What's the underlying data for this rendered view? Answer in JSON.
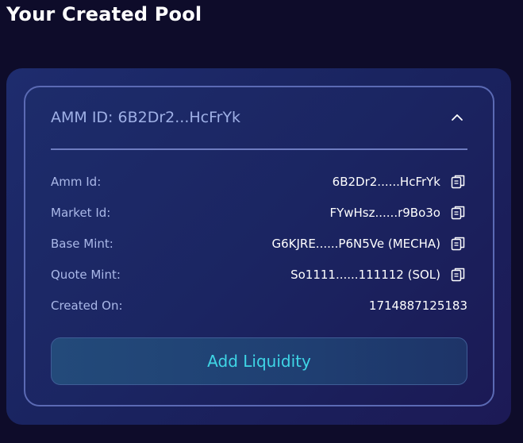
{
  "page_title": "Your Created Pool",
  "card": {
    "header_title": "AMM ID: 6B2Dr2...HcFrYk",
    "rows": [
      {
        "label": "Amm Id:",
        "value": "6B2Dr2......HcFrYk"
      },
      {
        "label": "Market Id:",
        "value": "FYwHsz......r9Bo3o"
      },
      {
        "label": "Base Mint:",
        "value": "G6KJRE......P6N5Ve (MECHA)"
      },
      {
        "label": "Quote Mint:",
        "value": "So1111......111112 (SOL)"
      },
      {
        "label": "Created On:",
        "value": "1714887125183"
      }
    ],
    "add_liquidity_label": "Add Liquidity"
  },
  "colors": {
    "background": "#0e0c2a",
    "accent": "#3fd6e6",
    "label": "#aab8e8",
    "border": "#5b6ab4"
  },
  "icons": {
    "collapse": "chevron-up-icon",
    "copy": "copy-icon"
  }
}
